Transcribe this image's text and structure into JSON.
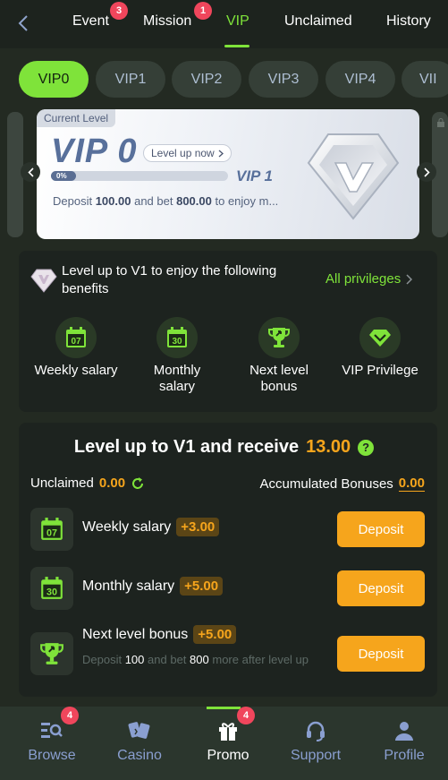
{
  "nav": {
    "tabs": [
      {
        "label": "Event",
        "badge": "3"
      },
      {
        "label": "Mission",
        "badge": "1"
      },
      {
        "label": "VIP"
      },
      {
        "label": "Unclaimed"
      },
      {
        "label": "History"
      }
    ],
    "active_tab": "VIP"
  },
  "vip_levels": [
    "VIP0",
    "VIP1",
    "VIP2",
    "VIP3",
    "VIP4",
    "VII"
  ],
  "level_card": {
    "tag": "Current Level",
    "current": "VIP 0",
    "level_up_label": "Level up now",
    "progress_text": "0%",
    "progress_fraction": 0,
    "next": "VIP 1",
    "desc_prefix": "Deposit",
    "deposit": "100.00",
    "desc_mid": "and bet",
    "bet": "800.00",
    "desc_suffix": "to enjoy m..."
  },
  "benefits": {
    "title": "Level up to V1 to enjoy the following benefits",
    "all_privileges": "All privileges",
    "items": [
      {
        "label": "Weekly salary",
        "icon_text": "07"
      },
      {
        "label": "Monthly salary",
        "icon_text": "30"
      },
      {
        "label": "Next level bonus"
      },
      {
        "label": "VIP Privilege"
      }
    ]
  },
  "receive": {
    "title": "Level up to V1 and receive",
    "amount": "13.00",
    "help": "?",
    "unclaimed_label": "Unclaimed",
    "unclaimed_value": "0.00",
    "accumulated_label": "Accumulated Bonuses",
    "accumulated_value": "0.00",
    "rows": [
      {
        "title": "Weekly salary",
        "plus": "+3.00",
        "icon_text": "07",
        "button": "Deposit"
      },
      {
        "title": "Monthly salary",
        "plus": "+5.00",
        "icon_text": "30",
        "button": "Deposit"
      },
      {
        "title": "Next level bonus",
        "plus": "+5.00",
        "button": "Deposit",
        "sub_prefix": "Deposit",
        "sub_deposit": "100",
        "sub_mid": "and bet",
        "sub_bet": "800",
        "sub_suffix": "more after level up"
      }
    ]
  },
  "bottom_nav": {
    "items": [
      {
        "label": "Browse",
        "badge": "4"
      },
      {
        "label": "Casino"
      },
      {
        "label": "Promo",
        "badge": "4"
      },
      {
        "label": "Support"
      },
      {
        "label": "Profile"
      }
    ],
    "active": "Promo"
  },
  "colors": {
    "accent": "#7fe33a",
    "orange": "#f6a51c",
    "badge": "#f0465c",
    "background": "#232a22"
  }
}
